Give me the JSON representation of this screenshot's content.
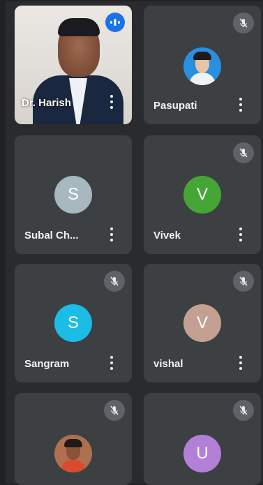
{
  "participants": [
    {
      "name": "Dr. Harish",
      "avatar_type": "video",
      "muted": false,
      "speaking": true
    },
    {
      "name": "Pasupati",
      "avatar_type": "photo",
      "muted": true
    },
    {
      "name": "Subal Ch...",
      "avatar_letter": "S",
      "avatar_color": "#a7b8c1",
      "muted": true
    },
    {
      "name": "Vivek",
      "avatar_letter": "V",
      "avatar_color": "#45a535",
      "muted": true
    },
    {
      "name": "Sangram",
      "avatar_letter": "S",
      "avatar_color": "#1bbde6",
      "muted": true
    },
    {
      "name": "vishal",
      "avatar_letter": "V",
      "avatar_color": "#c4a093",
      "muted": true
    },
    {
      "name": "",
      "avatar_type": "photo",
      "muted": true
    },
    {
      "name": "",
      "avatar_letter": "U",
      "avatar_color": "#b47fd6",
      "muted": true
    }
  ],
  "icons": {
    "speaking": "audio-level-icon",
    "muted": "mic-off-icon",
    "options": "more-vert-icon"
  },
  "colors": {
    "background": "#202124",
    "tile": "#3c4043",
    "speaking_badge": "#1a73e8",
    "mute_badge": "#5f6368"
  }
}
